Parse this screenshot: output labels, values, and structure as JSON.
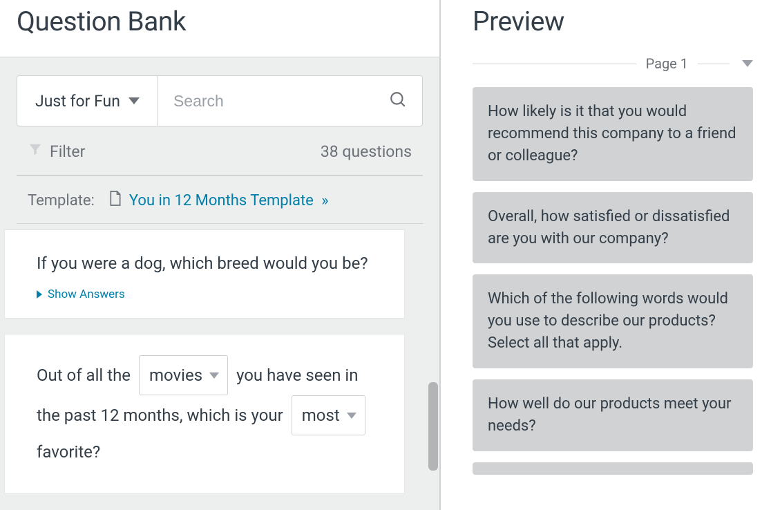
{
  "left": {
    "title": "Question Bank",
    "category": "Just for Fun",
    "search_placeholder": "Search",
    "filter_label": "Filter",
    "question_count": "38 questions",
    "template_label": "Template:",
    "template_link": "You in 12 Months Template",
    "show_answers_label": "Show Answers",
    "questions": [
      {
        "text": "If you were a dog, which breed would you be?"
      },
      {
        "parts": [
          "Out of all the ",
          "movies",
          " you have seen in the past 12 months, which is your ",
          "most",
          " favorite?"
        ]
      }
    ]
  },
  "right": {
    "title": "Preview",
    "page_label": "Page 1",
    "items": [
      "How likely is it that you would recommend this company to a friend or colleague?",
      "Overall, how satisfied or dissatisfied are you with our company?",
      "Which of the following words would you use to describe our products? Select all that apply.",
      "How well do our products meet your needs?"
    ]
  }
}
